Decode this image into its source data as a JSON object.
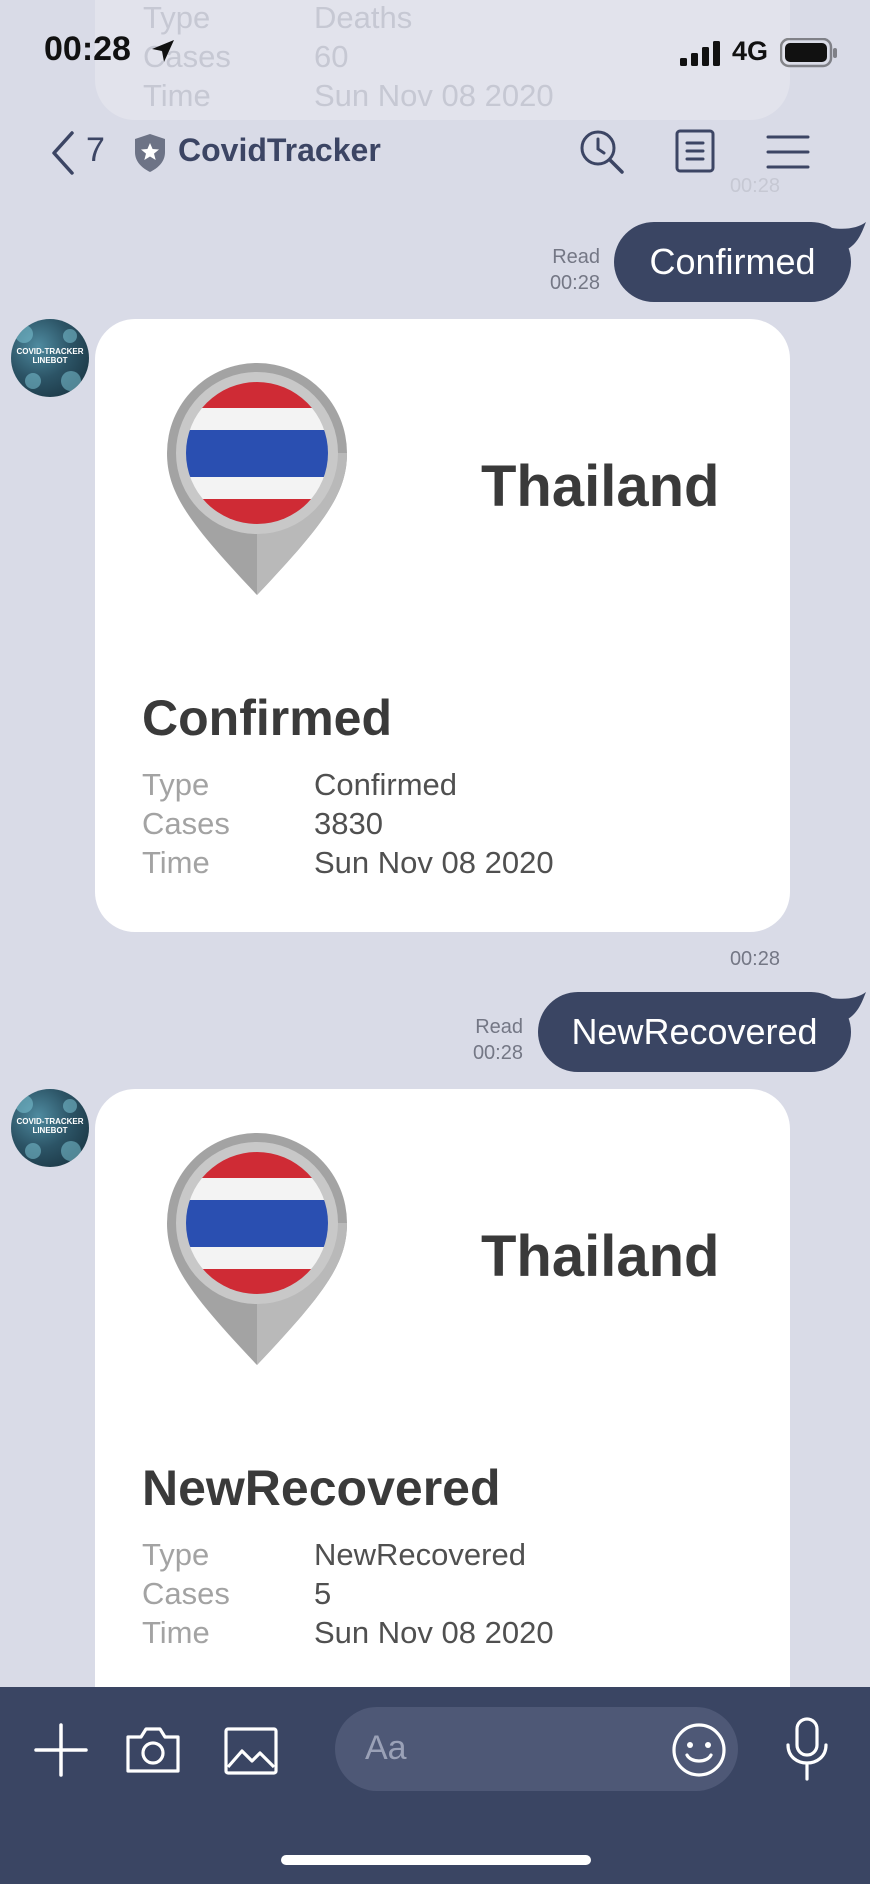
{
  "status_bar": {
    "time": "00:28",
    "network": "4G"
  },
  "nav": {
    "back_count": "7",
    "title": "CovidTracker"
  },
  "previous_card": {
    "rows": [
      {
        "key": "Type",
        "value": "Deaths"
      },
      {
        "key": "Cases",
        "value": "60"
      },
      {
        "key": "Time",
        "value": "Sun Nov 08 2020"
      }
    ],
    "time": "00:28"
  },
  "avatar": {
    "line1": "COVID-TRACKER",
    "line2": "LINEBOT"
  },
  "messages": [
    {
      "sent": {
        "text": "Confirmed",
        "read_label": "Read",
        "read_time": "00:28"
      },
      "card": {
        "country": "Thailand",
        "heading": "Confirmed",
        "rows": [
          {
            "key": "Type",
            "value": "Confirmed"
          },
          {
            "key": "Cases",
            "value": "3830"
          },
          {
            "key": "Time",
            "value": "Sun Nov 08 2020"
          }
        ],
        "time": "00:28"
      }
    },
    {
      "sent": {
        "text": "NewRecovered",
        "read_label": "Read",
        "read_time": "00:28"
      },
      "card": {
        "country": "Thailand",
        "heading": "NewRecovered",
        "rows": [
          {
            "key": "Type",
            "value": "NewRecovered"
          },
          {
            "key": "Cases",
            "value": "5"
          },
          {
            "key": "Time",
            "value": "Sun Nov 08 2020"
          }
        ]
      }
    }
  ],
  "composer": {
    "placeholder": "Aa"
  },
  "colors": {
    "background": "#d9dbe7",
    "bubble": "#3a4563",
    "bottom_bar": "#3a4563",
    "flag_red": "#cf2b35",
    "flag_blue": "#2a4fb1"
  }
}
